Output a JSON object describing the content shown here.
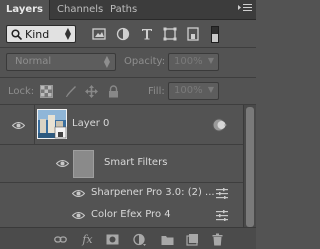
{
  "tabs": [
    {
      "label": "Layers",
      "active": true
    },
    {
      "label": "Channels",
      "active": false
    },
    {
      "label": "Paths",
      "active": false
    }
  ],
  "panel_menu_icon": "hamburger-icon",
  "filter": {
    "kind_label": "Kind",
    "icons": [
      "pixel-layer-filter-icon",
      "adjustment-layer-filter-icon",
      "type-layer-filter-icon",
      "shape-layer-filter-icon",
      "smart-object-filter-icon"
    ]
  },
  "blend": {
    "mode": "Normal",
    "opacity_label": "Opacity:",
    "opacity_value": "100%"
  },
  "lock": {
    "label": "Lock:",
    "fill_label": "Fill:",
    "fill_value": "100%"
  },
  "layers": [
    {
      "name": "Layer 0",
      "type": "smart-object"
    },
    {
      "name": "Smart Filters",
      "type": "smart-filters"
    },
    {
      "name": "Sharpener Pro 3.0: (2) ...",
      "type": "filter"
    },
    {
      "name": "Color Efex Pro 4",
      "type": "filter"
    }
  ],
  "bottom_icons": [
    "link-layers-icon",
    "fx-icon",
    "add-mask-icon",
    "adjustment-layer-icon",
    "new-group-icon",
    "new-layer-icon",
    "delete-layer-icon"
  ],
  "colors": {
    "panel_bg": "#535353",
    "tab_bar": "#3c3c3c",
    "text": "#d8d8d8"
  }
}
